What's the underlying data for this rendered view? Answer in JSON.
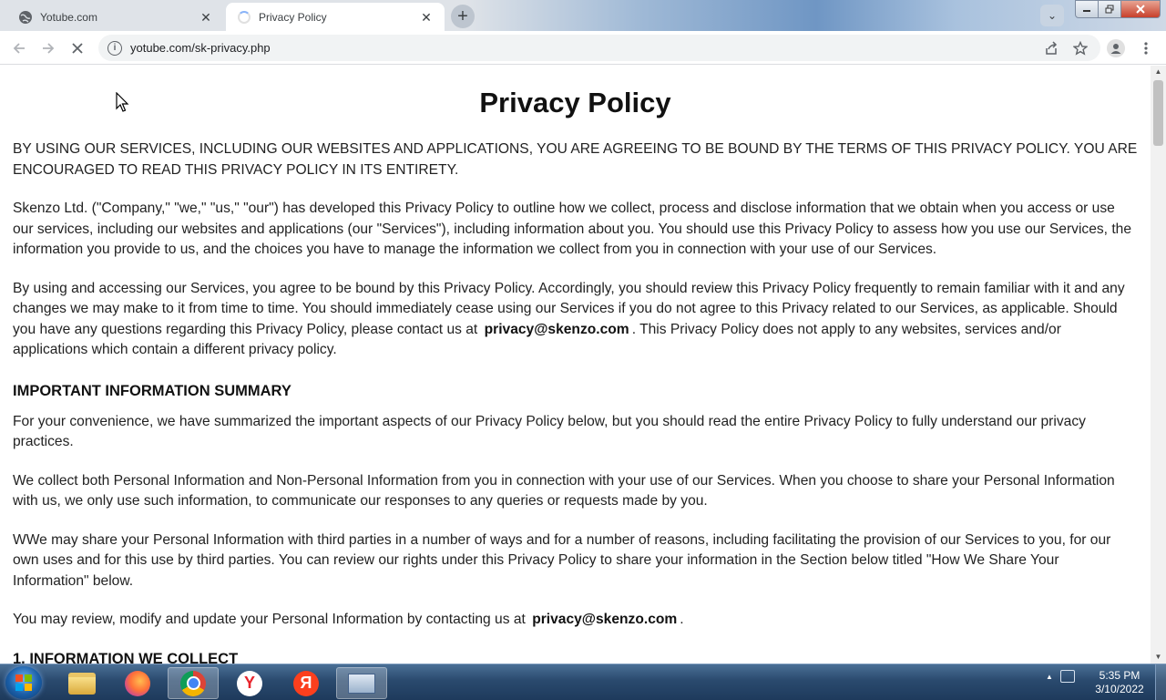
{
  "tabs": [
    {
      "title": "Yotube.com",
      "icon": "globe-icon",
      "close": "✕"
    },
    {
      "title": "Privacy Policy",
      "icon": "loading-spinner-icon",
      "close": "✕"
    }
  ],
  "new_tab_label": "+",
  "toolbar": {
    "url": "yotube.com/sk-privacy.php"
  },
  "page": {
    "title": "Privacy Policy",
    "intro": "BY USING OUR SERVICES, INCLUDING OUR WEBSITES AND APPLICATIONS, YOU ARE AGREEING TO BE BOUND BY THE TERMS OF THIS PRIVACY POLICY. YOU ARE ENCOURAGED TO READ THIS PRIVACY POLICY IN ITS ENTIRETY.",
    "p2": "Skenzo Ltd. (\"Company,\" \"we,\" \"us,\" \"our\") has developed this Privacy Policy to outline how we collect, process and disclose information that we obtain when you access or use our services, including our websites and applications (our \"Services\"), including information about you. You should use this Privacy Policy to assess how you use our Services, the information you provide to us, and the choices you have to manage the information we collect from you in connection with your use of our Services.",
    "p3_before": "By using and accessing our Services, you agree to be bound by this Privacy Policy. Accordingly, you should review this Privacy Policy frequently to remain familiar with it and any changes we may make to it from time to time. You should immediately cease using our Services if you do not agree to this Privacy related to our Services, as applicable. Should you have any questions regarding this Privacy Policy, please contact us at ",
    "email": "privacy@skenzo.com",
    "p3_after": ". This Privacy Policy does not apply to any websites, services and/or applications which contain a different privacy policy.",
    "summary_heading": "IMPORTANT INFORMATION SUMMARY",
    "s1": "For your convenience, we have summarized the important aspects of our Privacy Policy below, but you should read the entire Privacy Policy to fully understand our privacy practices.",
    "s2": "We collect both Personal Information and Non-Personal Information from you in connection with your use of our Services. When you choose to share your Personal Information with us, we only use such information, to communicate our responses to any queries or requests made by you.",
    "s3": "WWe may share your Personal Information with third parties in a number of ways and for a number of reasons, including facilitating the provision of our Services to you, for our own uses and for this use by third parties. You can review our rights under this Privacy Policy to share your information in the Section below titled \"How We Share Your Information\" below.",
    "s4_before": "You may review, modify and update your Personal Information by contacting us at ",
    "s4_after": ".",
    "section1_heading": "1. INFORMATION WE COLLECT"
  },
  "taskbar": {
    "time": "5:35 PM",
    "date": "3/10/2022",
    "yandex_browser_glyph": "Y",
    "yandex_glyph": "Я"
  }
}
